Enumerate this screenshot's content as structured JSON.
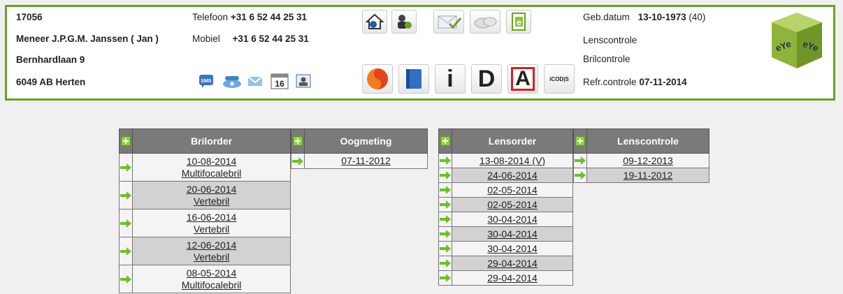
{
  "patient": {
    "id": "17056",
    "name": "Meneer J.P.G.M. Janssen ( Jan )",
    "street": "Bernhardlaan 9",
    "city": "6049 AB Herten",
    "phone_label": "Telefoon",
    "phone": "+31 6 52 44 25 31",
    "mobile_label": "Mobiel",
    "mobile": "+31 6 52 44 25 31",
    "dob_label": "Geb.datum",
    "dob": "13-10-1973",
    "age": "(40)",
    "lens_check_label": "Lenscontrole",
    "glasses_check_label": "Brilcontrole",
    "refr_label": "Refr.controle",
    "refr_date": "07-11-2014"
  },
  "icons_top": [
    "home-icon",
    "user-admin-icon",
    "mail-check-icon",
    "disc-icon",
    "document-e-icon"
  ],
  "icons_bottom_small": [
    "sms-icon",
    "phone-icon",
    "envelope-icon",
    "calendar-16-icon",
    "contact-card-icon"
  ],
  "calendar_day": "16",
  "sms_text": "SMS",
  "icons_bottom_large": {
    "i_label": "i",
    "d_label": "D",
    "a_label": "A",
    "codis_label": "iCOD|S"
  },
  "logo_text": "eYeeYe",
  "tables": {
    "brilorder": {
      "header": "Brilorder",
      "rows": [
        {
          "date": "10-08-2014",
          "type": "Multifocalebril"
        },
        {
          "date": "20-06-2014",
          "type": "Vertebril"
        },
        {
          "date": "16-06-2014",
          "type": "Vertebril"
        },
        {
          "date": "12-06-2014",
          "type": "Vertebril"
        },
        {
          "date": "08-05-2014",
          "type": "Multifocalebril"
        }
      ]
    },
    "oogmeting": {
      "header": "Oogmeting",
      "rows": [
        {
          "date": "07-11-2012"
        }
      ]
    },
    "lensorder": {
      "header": "Lensorder",
      "rows": [
        {
          "date": "13-08-2014 (V)"
        },
        {
          "date": "24-06-2014"
        },
        {
          "date": "02-05-2014"
        },
        {
          "date": "02-05-2014"
        },
        {
          "date": "30-04-2014"
        },
        {
          "date": "30-04-2014"
        },
        {
          "date": "30-04-2014"
        },
        {
          "date": "29-04-2014"
        },
        {
          "date": "29-04-2014"
        }
      ]
    },
    "lenscontrole": {
      "header": "Lenscontrole",
      "rows": [
        {
          "date": "09-12-2013"
        },
        {
          "date": "19-11-2012"
        }
      ]
    }
  }
}
